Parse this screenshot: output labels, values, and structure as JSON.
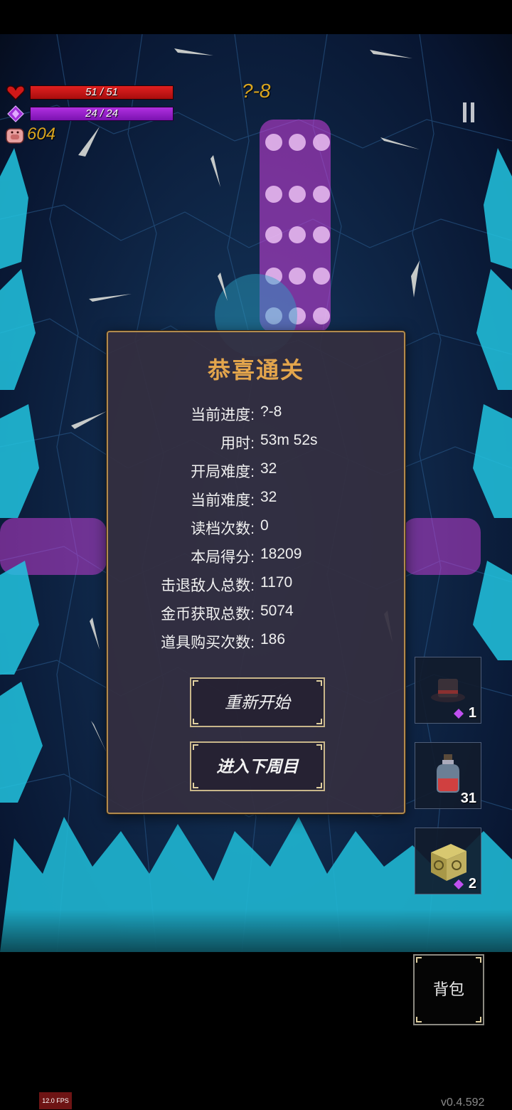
{
  "hud": {
    "hp_text": "51 / 51",
    "mp_text": "24 / 24",
    "gold": "604",
    "level": "?-8",
    "hp_fraction": 1.0,
    "mp_fraction": 1.0
  },
  "dialog": {
    "title": "恭喜通关",
    "stats": [
      {
        "label": "当前进度:",
        "value": "?-8"
      },
      {
        "label": "用时:",
        "value": "53m 52s"
      },
      {
        "label": "开局难度:",
        "value": "32"
      },
      {
        "label": "当前难度:",
        "value": "32"
      },
      {
        "label": "读档次数:",
        "value": "0"
      },
      {
        "label": "本局得分:",
        "value": "18209"
      },
      {
        "label": "击退敌人总数:",
        "value": "1170"
      },
      {
        "label": "金币获取总数:",
        "value": "5074"
      },
      {
        "label": "道具购买次数:",
        "value": "186"
      }
    ],
    "restart_label": "重新开始",
    "next_cycle_label": "进入下周目"
  },
  "items": [
    {
      "icon": "top-hat-icon",
      "count": "1",
      "has_gem": true
    },
    {
      "icon": "potion-bottle-icon",
      "count": "31",
      "has_gem": false
    },
    {
      "icon": "rune-cube-icon",
      "count": "2",
      "has_gem": true
    }
  ],
  "bag_label": "背包",
  "fps": "12.0 FPS",
  "version": "v0.4.592",
  "colors": {
    "hp": "#d01818",
    "mp": "#9020c8",
    "gold": "#d9a520",
    "title": "#e3a54c",
    "crystal": "#22c4e0",
    "magic": "#d040e0"
  }
}
